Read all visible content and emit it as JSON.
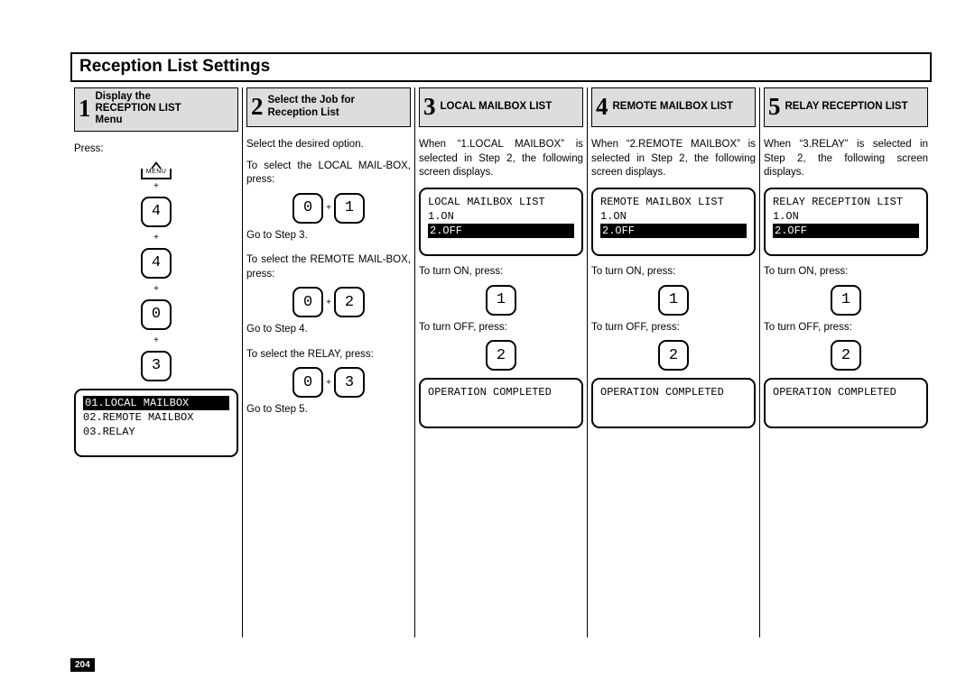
{
  "title": "Reception List Settings",
  "page_number": "204",
  "plus": "+",
  "col1": {
    "num": "1",
    "header": "Display the<br><b>RECEPTION LIST</b><br>Menu",
    "header_l1": "Display the",
    "header_l2": "RECEPTION LIST",
    "header_l3": "Menu",
    "press": "Press:",
    "menu_label": "MENU",
    "k1": "4",
    "k2": "4",
    "k3": "0",
    "k4": "3",
    "lcd_sel": "01.LOCAL MAILBOX",
    "lcd_l2": "02.REMOTE MAILBOX",
    "lcd_l3": "03.RELAY"
  },
  "col2": {
    "num": "2",
    "header_l1": "Select the Job for",
    "header_l2": "Reception List",
    "t1": "Select the desired option.",
    "t2": "To select the LOCAL MAIL-BOX, press:",
    "k_a1": "0",
    "k_a2": "1",
    "g3": "Go to Step 3.",
    "t3": "To select the REMOTE MAIL-BOX, press:",
    "k_b1": "0",
    "k_b2": "2",
    "g4": "Go to Step 4.",
    "t4": "To select the RELAY, press:",
    "k_c1": "0",
    "k_c2": "3",
    "g5": "Go to Step 5."
  },
  "col3": {
    "num": "3",
    "header_l1": "LOCAL MAILBOX LIST",
    "intro": "When “1.LOCAL MAILBOX” is selected in Step 2, the following screen displays.",
    "lcd_t": "LOCAL MAILBOX LIST",
    "lcd_1": "1.ON",
    "lcd_2": "2.OFF",
    "on_label": "To turn ON, press:",
    "on_key": "1",
    "off_label": "To turn OFF, press:",
    "off_key": "2",
    "done": "OPERATION COMPLETED"
  },
  "col4": {
    "num": "4",
    "header_l1": "REMOTE MAILBOX LIST",
    "intro": "When “2.REMOTE MAILBOX” is selected in Step 2, the following screen displays.",
    "lcd_t": "REMOTE MAILBOX LIST",
    "lcd_1": "1.ON",
    "lcd_2": "2.OFF",
    "on_label": "To turn ON, press:",
    "on_key": "1",
    "off_label": "To turn OFF, press:",
    "off_key": "2",
    "done": "OPERATION COMPLETED"
  },
  "col5": {
    "num": "5",
    "header_l1": "RELAY RECEPTION LIST",
    "intro": "When “3.RELAY” is selected in Step 2, the following screen displays.",
    "lcd_t": "RELAY RECEPTION LIST",
    "lcd_1": "1.ON",
    "lcd_2": "2.OFF",
    "on_label": "To turn ON, press:",
    "on_key": "1",
    "off_label": "To turn OFF, press:",
    "off_key": "2",
    "done": "OPERATION COMPLETED"
  }
}
